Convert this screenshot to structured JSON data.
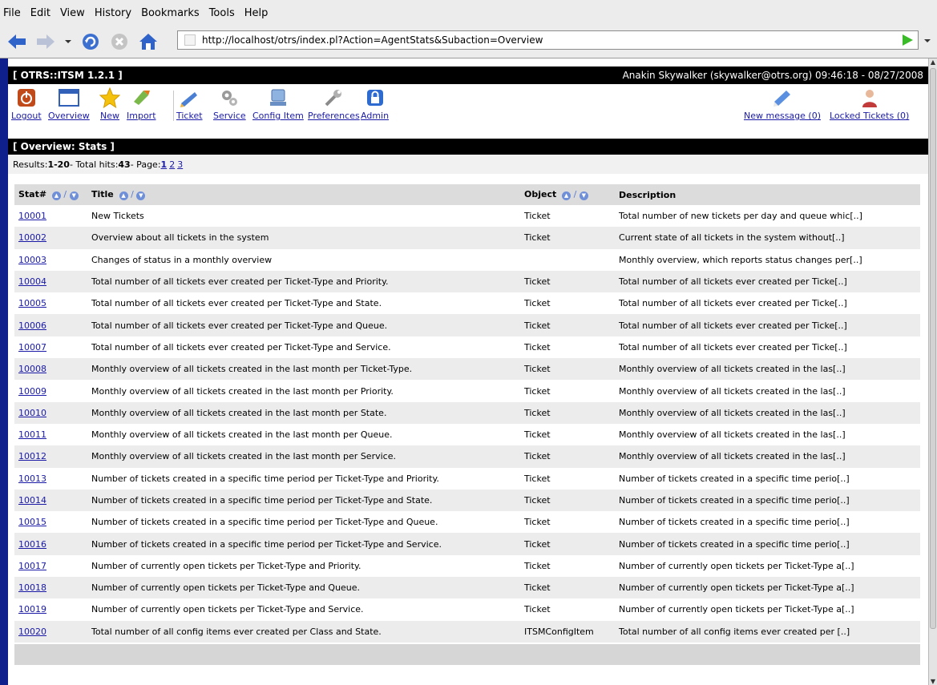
{
  "browser": {
    "menu": [
      "File",
      "Edit",
      "View",
      "History",
      "Bookmarks",
      "Tools",
      "Help"
    ],
    "url": "http://localhost/otrs/index.pl?Action=AgentStats&Subaction=Overview"
  },
  "header": {
    "app_title": "[ OTRS::ITSM 1.2.1 ]",
    "user_info": "Anakin Skywalker (skywalker@otrs.org) 09:46:18 - 08/27/2008"
  },
  "toolbar": {
    "left": [
      {
        "label": "Logout",
        "icon": "power-icon"
      },
      {
        "label": "Overview",
        "icon": "window-icon"
      },
      {
        "label": "New",
        "icon": "star-icon"
      },
      {
        "label": "Import",
        "icon": "import-icon"
      }
    ],
    "middle": [
      {
        "label": "Ticket",
        "icon": "ticket-icon"
      },
      {
        "label": "Service",
        "icon": "gears-icon"
      },
      {
        "label": "Config Item",
        "icon": "config-item-icon"
      },
      {
        "label": "Preferences",
        "icon": "wrench-icon"
      },
      {
        "label": "Admin",
        "icon": "lock-icon"
      }
    ],
    "right": [
      {
        "label": "New message (0)",
        "icon": "message-icon"
      },
      {
        "label": "Locked Tickets (0)",
        "icon": "user-icon"
      }
    ]
  },
  "section_title": "[ Overview: Stats ]",
  "results": {
    "prefix": "Results: ",
    "range": "1-20",
    "middle": " - Total hits: ",
    "total": "43",
    "page_label": " - Page: ",
    "pages": [
      "1",
      "2",
      "3"
    ]
  },
  "table": {
    "headers": [
      "Stat#",
      "Title",
      "Object",
      "Description"
    ],
    "rows": [
      {
        "stat": "10001",
        "title": "New Tickets",
        "object": "Ticket",
        "description": "Total number of new tickets per day and queue whic[..]"
      },
      {
        "stat": "10002",
        "title": "Overview about all tickets in the system",
        "object": "Ticket",
        "description": "Current state of all tickets in the system without[..]"
      },
      {
        "stat": "10003",
        "title": "Changes of status in a monthly overview",
        "object": "",
        "description": "Monthly overview, which reports status changes per[..]"
      },
      {
        "stat": "10004",
        "title": "Total number of all tickets ever created per Ticket-Type and Priority.",
        "object": "Ticket",
        "description": "Total number of all tickets ever created per Ticke[..]"
      },
      {
        "stat": "10005",
        "title": "Total number of all tickets ever created per Ticket-Type and State.",
        "object": "Ticket",
        "description": "Total number of all tickets ever created per Ticke[..]"
      },
      {
        "stat": "10006",
        "title": "Total number of all tickets ever created per Ticket-Type and Queue.",
        "object": "Ticket",
        "description": "Total number of all tickets ever created per Ticke[..]"
      },
      {
        "stat": "10007",
        "title": "Total number of all tickets ever created per Ticket-Type and Service.",
        "object": "Ticket",
        "description": "Total number of all tickets ever created per Ticke[..]"
      },
      {
        "stat": "10008",
        "title": "Monthly overview of all tickets created in the last month per Ticket-Type.",
        "object": "Ticket",
        "description": "Monthly overview of all tickets created in the las[..]"
      },
      {
        "stat": "10009",
        "title": "Monthly overview of all tickets created in the last month per Priority.",
        "object": "Ticket",
        "description": "Monthly overview of all tickets created in the las[..]"
      },
      {
        "stat": "10010",
        "title": "Monthly overview of all tickets created in the last month per State.",
        "object": "Ticket",
        "description": "Monthly overview of all tickets created in the las[..]"
      },
      {
        "stat": "10011",
        "title": "Monthly overview of all tickets created in the last month per Queue.",
        "object": "Ticket",
        "description": "Monthly overview of all tickets created in the las[..]"
      },
      {
        "stat": "10012",
        "title": "Monthly overview of all tickets created in the last month per Service.",
        "object": "Ticket",
        "description": "Monthly overview of all tickets created in the las[..]"
      },
      {
        "stat": "10013",
        "title": "Number of tickets created in a specific time period per Ticket-Type and Priority.",
        "object": "Ticket",
        "description": "Number of tickets created in a specific time perio[..]"
      },
      {
        "stat": "10014",
        "title": "Number of tickets created in a specific time period per Ticket-Type and State.",
        "object": "Ticket",
        "description": "Number of tickets created in a specific time perio[..]"
      },
      {
        "stat": "10015",
        "title": "Number of tickets created in a specific time period per Ticket-Type and Queue.",
        "object": "Ticket",
        "description": "Number of tickets created in a specific time perio[..]"
      },
      {
        "stat": "10016",
        "title": "Number of tickets created in a specific time period per Ticket-Type and Service.",
        "object": "Ticket",
        "description": "Number of tickets created in a specific time perio[..]"
      },
      {
        "stat": "10017",
        "title": "Number of currently open tickets per Ticket-Type and Priority.",
        "object": "Ticket",
        "description": "Number of currently open tickets per Ticket-Type a[..]"
      },
      {
        "stat": "10018",
        "title": "Number of currently open tickets per Ticket-Type and Queue.",
        "object": "Ticket",
        "description": "Number of currently open tickets per Ticket-Type a[..]"
      },
      {
        "stat": "10019",
        "title": "Number of currently open tickets per Ticket-Type and Service.",
        "object": "Ticket",
        "description": "Number of currently open tickets per Ticket-Type a[..]"
      },
      {
        "stat": "10020",
        "title": "Total number of all config items ever created per Class and State.",
        "object": "ITSMConfigItem",
        "description": "Total number of all config items ever created per [..]"
      }
    ]
  }
}
